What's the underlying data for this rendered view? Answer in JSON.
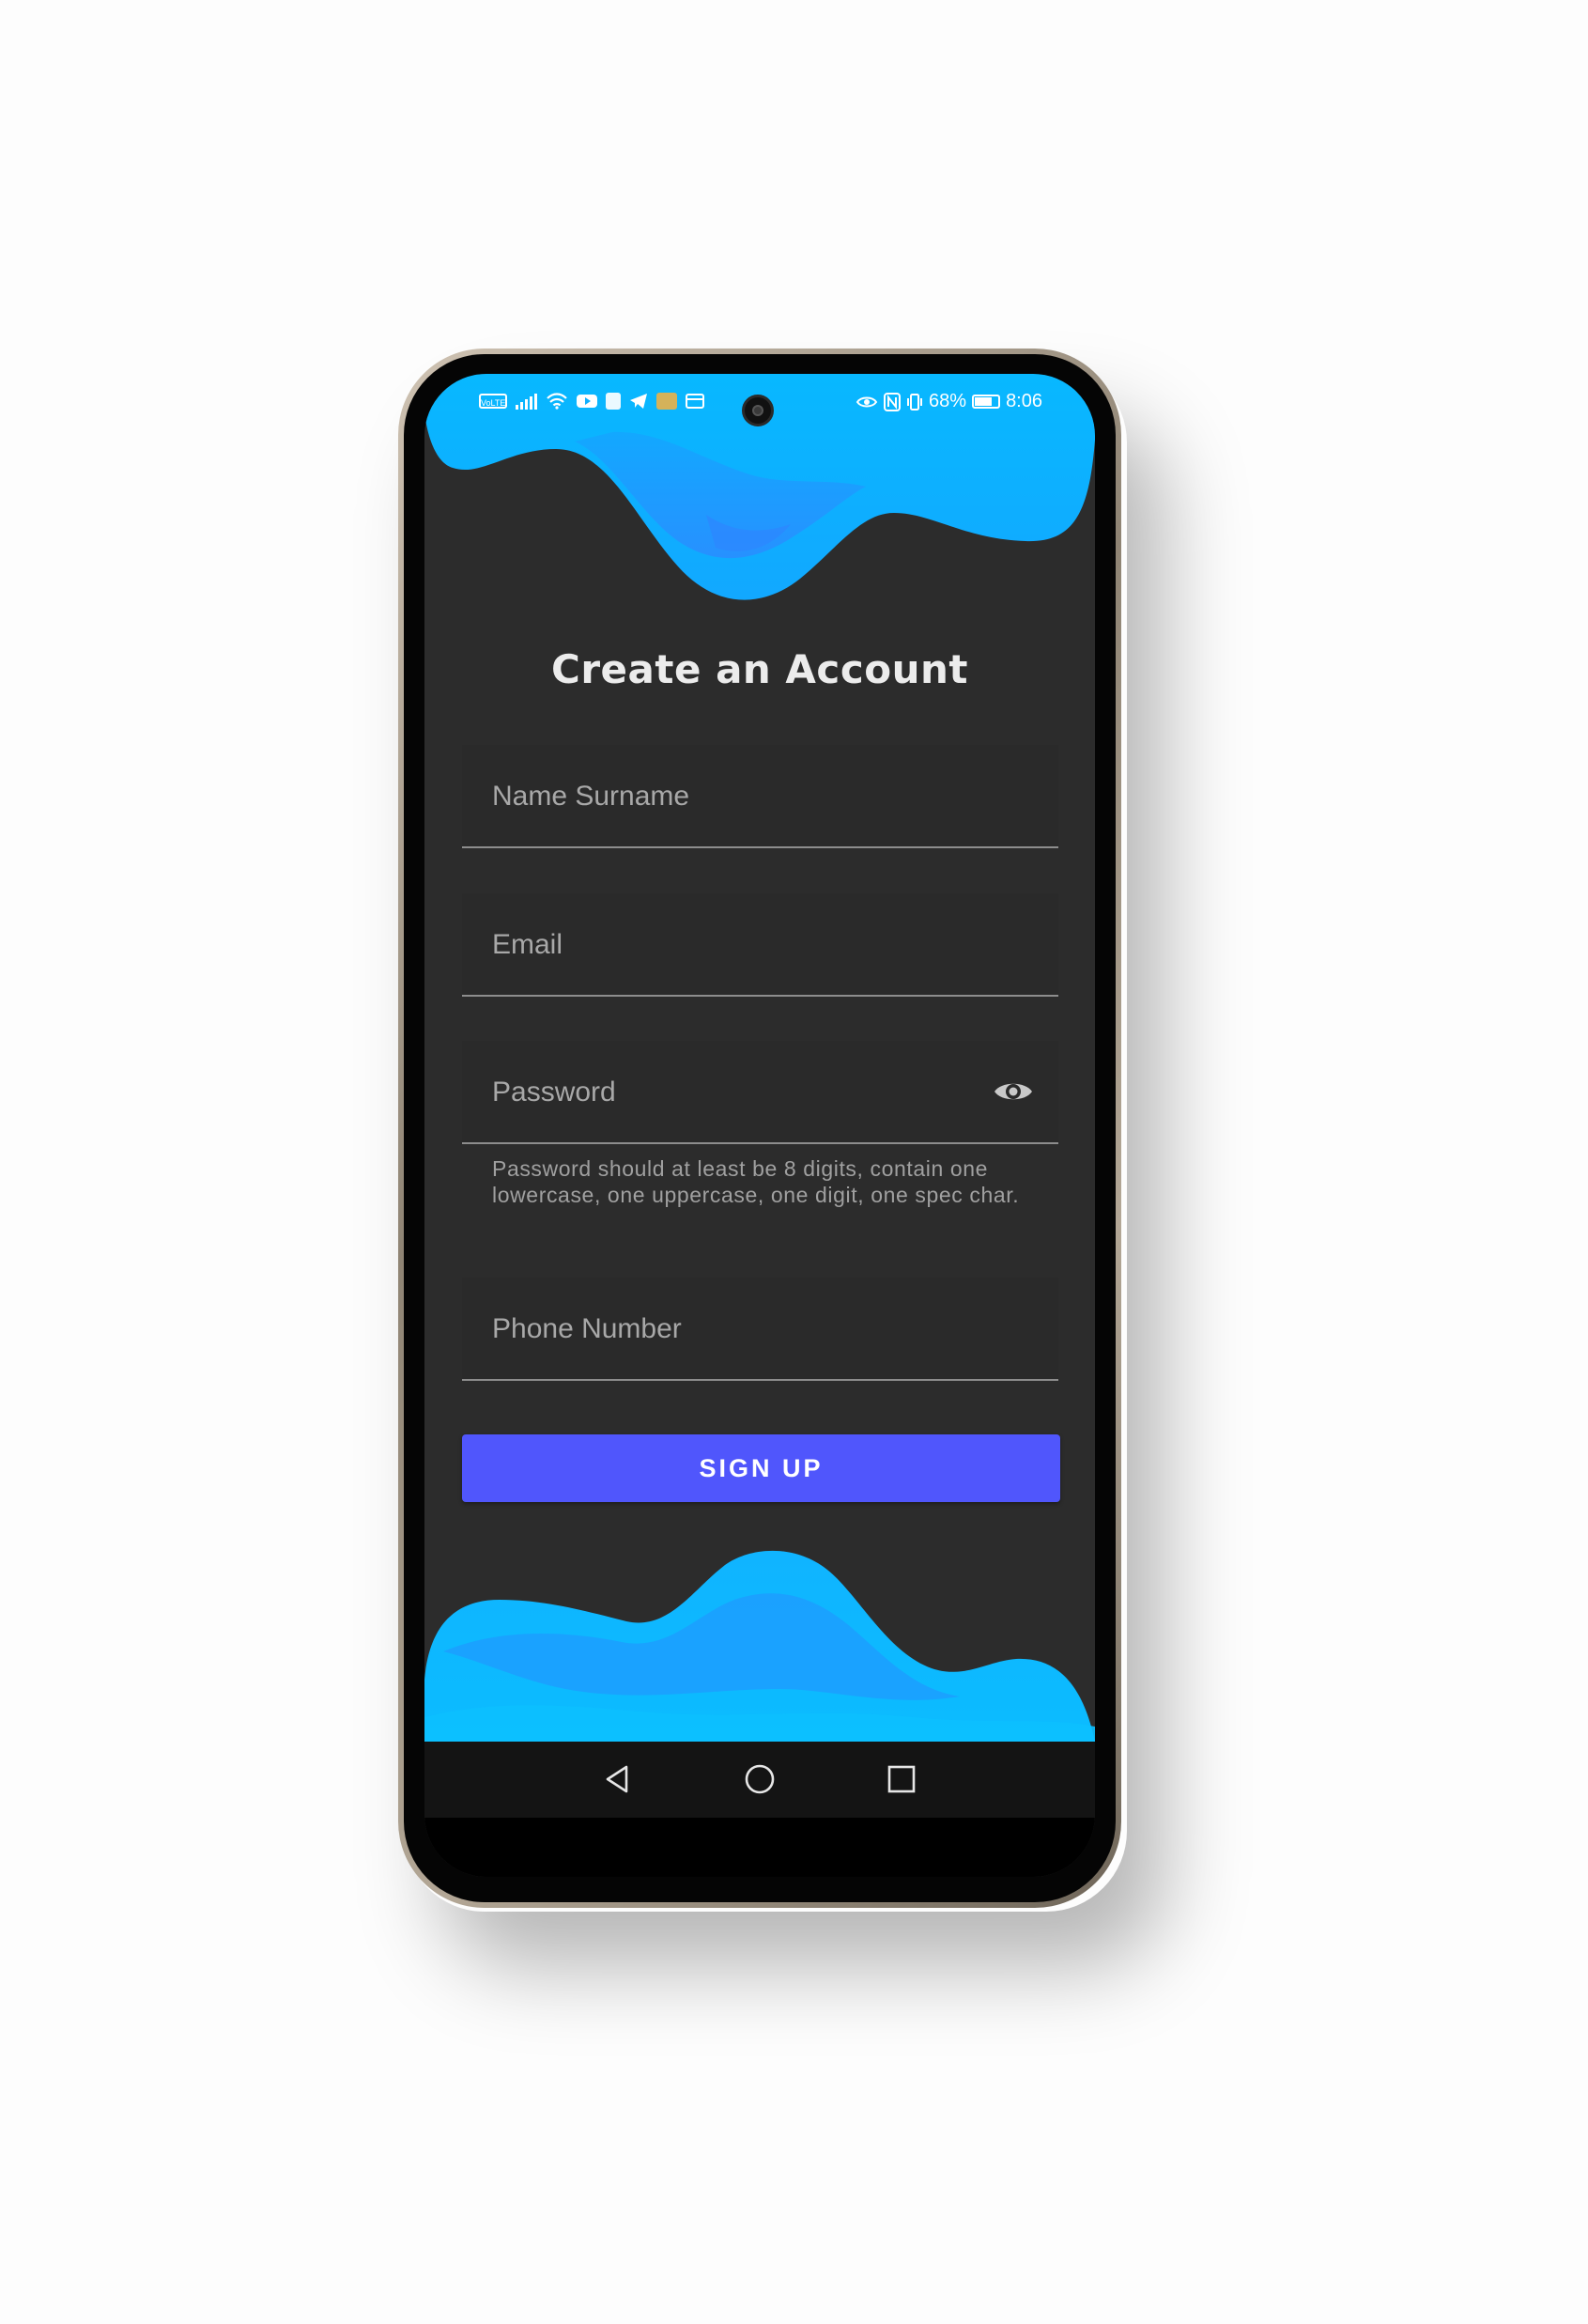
{
  "status_bar": {
    "left_icons": [
      "volte-icon",
      "signal-icon",
      "wifi-icon",
      "youtube-icon",
      "app-icon",
      "telegram-icon",
      "game-icon",
      "card-icon"
    ],
    "battery_percent": "68%",
    "battery_level": 0.68,
    "time": "8:06"
  },
  "screen": {
    "title": "Create an Account",
    "fields": {
      "name": {
        "placeholder": "Name Surname"
      },
      "email": {
        "placeholder": "Email"
      },
      "password": {
        "placeholder": "Password",
        "helper": "Password should at least be 8 digits, contain one lowercase, one uppercase, one digit, one spec char.",
        "toggle_icon": "eye-icon"
      },
      "phone": {
        "placeholder": "Phone Number"
      }
    },
    "signup_label": "SIGN UP"
  },
  "nav_bar": {
    "icons": [
      "back-triangle-icon",
      "home-circle-icon",
      "recents-square-icon"
    ]
  },
  "colors": {
    "background": "#2c2c2c",
    "wave_light": "#0ab4ff",
    "wave_dark": "#2196ff",
    "button": "#5056fc",
    "field_bg": "#2a2a2a",
    "text_primary": "#ececec",
    "text_hint": "#a8a8a8"
  }
}
